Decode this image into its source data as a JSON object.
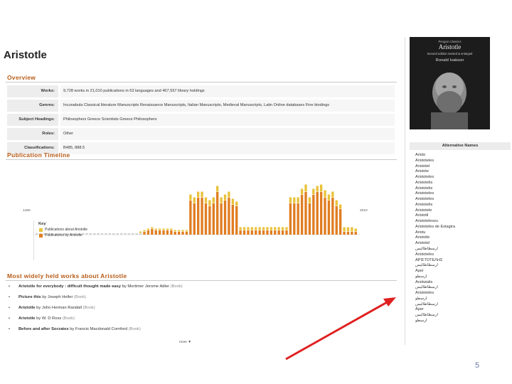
{
  "page": {
    "title": "Aristotle",
    "slide_number": "5"
  },
  "overview": {
    "heading": "Overview",
    "rows": [
      {
        "label": "Works:",
        "value": "9,728 works in 21,010 publications in 63 languages and 467,557 library holdings"
      },
      {
        "label": "Genres:",
        "value": "Incunabula  Classical literature  Manuscripts  Renaissance  Manuscripts, Italian  Manuscripts, Medieval  Manuscripts, Latin  Online databases  Fine bindings"
      },
      {
        "label": "Subject Headings:",
        "value": "Philosophers  Greece  Scientists  Greece  Philosophers"
      },
      {
        "label": "Roles:",
        "value": "Other"
      },
      {
        "label": "Classifications:",
        "value": "B485, 888.5"
      }
    ]
  },
  "timeline": {
    "heading": "Publication Timeline",
    "start_label": "1460",
    "end_label": "2010",
    "key": {
      "title": "Key",
      "items": [
        {
          "label": "Publications about Aristotle",
          "color": "#e8c23a"
        },
        {
          "label": "Publications by Aristotle",
          "color": "#e07d22"
        }
      ]
    },
    "bars": [
      {
        "about": 0,
        "by": 1
      },
      {
        "about": 0,
        "by": 1
      },
      {
        "about": 0,
        "by": 1
      },
      {
        "about": 0,
        "by": 1
      },
      {
        "about": 0,
        "by": 1
      },
      {
        "about": 0,
        "by": 1
      },
      {
        "about": 0,
        "by": 1
      },
      {
        "about": 0,
        "by": 1
      },
      {
        "about": 0,
        "by": 1
      },
      {
        "about": 0,
        "by": 1
      },
      {
        "about": 0,
        "by": 1
      },
      {
        "about": 0,
        "by": 1
      },
      {
        "about": 0,
        "by": 1
      },
      {
        "about": 0,
        "by": 1
      },
      {
        "about": 0,
        "by": 1
      },
      {
        "about": 0,
        "by": 1
      },
      {
        "about": 0,
        "by": 1
      },
      {
        "about": 0,
        "by": 1
      },
      {
        "about": 0,
        "by": 1
      },
      {
        "about": 0,
        "by": 1
      },
      {
        "about": 0,
        "by": 1
      },
      {
        "about": 0,
        "by": 1
      },
      {
        "about": 0,
        "by": 1
      },
      {
        "about": 0,
        "by": 1
      },
      {
        "about": 0,
        "by": 1
      },
      {
        "about": 0,
        "by": 1
      },
      {
        "about": 0,
        "by": 1
      },
      {
        "about": 1,
        "by": 1
      },
      {
        "about": 1,
        "by": 2
      },
      {
        "about": 1,
        "by": 3
      },
      {
        "about": 1,
        "by": 4
      },
      {
        "about": 1,
        "by": 3
      },
      {
        "about": 1,
        "by": 3
      },
      {
        "about": 1,
        "by": 3
      },
      {
        "about": 1,
        "by": 3
      },
      {
        "about": 1,
        "by": 3
      },
      {
        "about": 1,
        "by": 2
      },
      {
        "about": 1,
        "by": 2
      },
      {
        "about": 1,
        "by": 2
      },
      {
        "about": 1,
        "by": 2
      },
      {
        "about": 4,
        "by": 24
      },
      {
        "about": 4,
        "by": 22
      },
      {
        "about": 4,
        "by": 26
      },
      {
        "about": 4,
        "by": 26
      },
      {
        "about": 4,
        "by": 22
      },
      {
        "about": 4,
        "by": 20
      },
      {
        "about": 4,
        "by": 22
      },
      {
        "about": 4,
        "by": 30
      },
      {
        "about": 4,
        "by": 22
      },
      {
        "about": 4,
        "by": 24
      },
      {
        "about": 4,
        "by": 26
      },
      {
        "about": 4,
        "by": 21
      },
      {
        "about": 3,
        "by": 20
      },
      {
        "about": 2,
        "by": 3
      },
      {
        "about": 2,
        "by": 3
      },
      {
        "about": 2,
        "by": 3
      },
      {
        "about": 2,
        "by": 3
      },
      {
        "about": 2,
        "by": 3
      },
      {
        "about": 2,
        "by": 3
      },
      {
        "about": 2,
        "by": 3
      },
      {
        "about": 2,
        "by": 3
      },
      {
        "about": 2,
        "by": 3
      },
      {
        "about": 2,
        "by": 3
      },
      {
        "about": 2,
        "by": 3
      },
      {
        "about": 2,
        "by": 3
      },
      {
        "about": 2,
        "by": 3
      },
      {
        "about": 4,
        "by": 22
      },
      {
        "about": 4,
        "by": 22
      },
      {
        "about": 4,
        "by": 22
      },
      {
        "about": 4,
        "by": 28
      },
      {
        "about": 5,
        "by": 30
      },
      {
        "about": 4,
        "by": 22
      },
      {
        "about": 4,
        "by": 28
      },
      {
        "about": 4,
        "by": 30
      },
      {
        "about": 5,
        "by": 30
      },
      {
        "about": 5,
        "by": 26
      },
      {
        "about": 4,
        "by": 24
      },
      {
        "about": 4,
        "by": 26
      },
      {
        "about": 4,
        "by": 20
      },
      {
        "about": 3,
        "by": 18
      },
      {
        "about": 3,
        "by": 2
      },
      {
        "about": 3,
        "by": 2
      },
      {
        "about": 3,
        "by": 2
      },
      {
        "about": 2,
        "by": 2
      }
    ]
  },
  "works": {
    "heading": "Most widely held works about Aristotle",
    "items": [
      {
        "title": "Aristotle for everybody : difficult thought made easy",
        "author": "by Mortimer Jerome Adler",
        "type": "(Book)"
      },
      {
        "title": "Picture this",
        "author": "by Joseph Heller",
        "type": "(Book)"
      },
      {
        "title": "Aristotle",
        "author": "by John Herman Randall",
        "type": "(Book)"
      },
      {
        "title": "Aristotle",
        "author": "by W. D Ross",
        "type": "(Book)"
      },
      {
        "title": "Before and after Socrates",
        "author": "by Francis Macdonald Cornford",
        "type": "(Book)"
      }
    ],
    "more_label": "more ▼"
  },
  "cover": {
    "series": "Penguin Classics",
    "title": "Aristotle",
    "subtitle": "Second edition revised & enlarged",
    "author": "Ronald Ivakson"
  },
  "alternative_names": {
    "heading": "Alternative Names",
    "items": [
      "Aristo",
      "Aristoteles",
      "Aristotel",
      "Aristote",
      "Aristoteles",
      "Aristotelis",
      "Aristotelis",
      "Aristoteles",
      "Aristoteles",
      "Aristotelis",
      "Aristotele",
      "Aristotil",
      "Aristoteleszu",
      "Aristoteles de Estagira",
      "Aristu",
      "Aristotle",
      "Aristotel",
      "ارسطاطالیس",
      "Aristoteles",
      "ΑΡΙΣΤΟΤΕΛΗΣ",
      "ارسطاطالیس",
      "Αρισ",
      "ارسطو",
      "Arsitutalis",
      "ارسطاطالیس",
      "Aristoteles",
      "ارسطو",
      "ارسطاطالیس",
      "Αρισ",
      "ارسطاطالیس",
      "ارسطو"
    ]
  },
  "colors": {
    "accent": "#b85c18",
    "about_bar": "#e8c23a",
    "by_bar": "#e07d22",
    "arrow": "#e02020",
    "page_number": "#6a7aa6"
  }
}
